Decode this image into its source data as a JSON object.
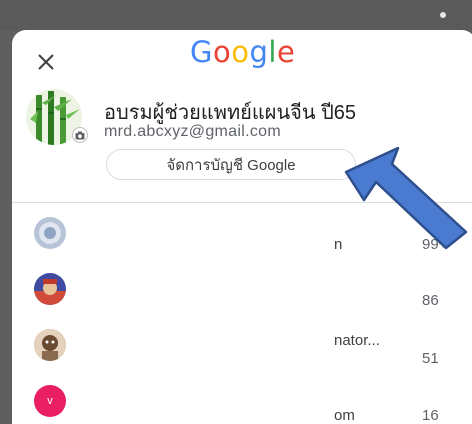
{
  "header": {
    "logo_letters": [
      {
        "ch": "G",
        "color": "#4285F4"
      },
      {
        "ch": "o",
        "color": "#EA4335"
      },
      {
        "ch": "o",
        "color": "#FBBC05"
      },
      {
        "ch": "g",
        "color": "#4285F4"
      },
      {
        "ch": "l",
        "color": "#34A853"
      },
      {
        "ch": "e",
        "color": "#EA4335"
      }
    ],
    "close_icon": "close-icon"
  },
  "account": {
    "name": "อบรมผู้ช่วยแพทย์แผนจีน ปี65",
    "email": "mrd.abcxyz@gmail.com",
    "manage_label": "จัดการบัญชี Google"
  },
  "other_accounts": [
    {
      "name": "n",
      "count": "99+",
      "avatar_color": "#b7c3d6"
    },
    {
      "name": "",
      "count": "86",
      "avatar_color": "#3f4aa0"
    },
    {
      "name": "nator...",
      "count": "51",
      "avatar_color": "#caa080"
    },
    {
      "name": "om",
      "count": "16",
      "avatar_color": "#e91e63",
      "letter": "v"
    }
  ],
  "colors": {
    "annotation_arrow": "#4a7bd0",
    "divider": "#dadce0"
  }
}
